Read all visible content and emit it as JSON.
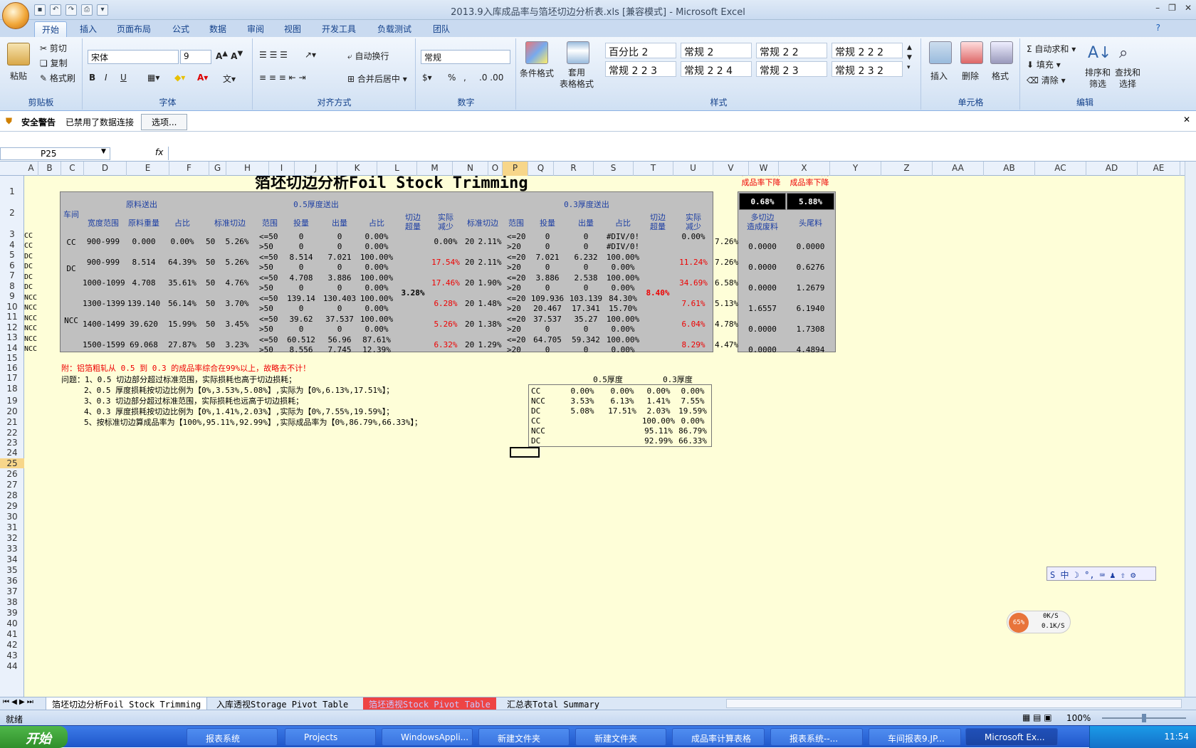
{
  "window": {
    "title": "2013.9入库成品率与箔坯切边分析表.xls  [兼容模式] - Microsoft Excel"
  },
  "ribbon": {
    "tabs": [
      "开始",
      "插入",
      "页面布局",
      "公式",
      "数据",
      "审阅",
      "视图",
      "开发工具",
      "负载测试",
      "团队"
    ],
    "clipboard": {
      "paste": "粘贴",
      "cut": "剪切",
      "copy": "复制",
      "format_painter": "格式刷",
      "label": "剪贴板"
    },
    "font": {
      "name": "宋体",
      "size": "9",
      "label": "字体"
    },
    "alignment": {
      "wrap": "自动换行",
      "merge": "合并后居中",
      "label": "对齐方式"
    },
    "number": {
      "format": "常规",
      "percent": "%",
      "label": "数字"
    },
    "styles": {
      "cond": "条件格式",
      "table": "套用\n表格格式",
      "boxes": [
        "百分比 2",
        "常规 2",
        "常规 2 2",
        "常规 2 2 2",
        "常规 2 2 3",
        "常规 2 2 4",
        "常规 2 3",
        "常规 2 3 2"
      ],
      "label": "样式"
    },
    "cells": {
      "insert": "插入",
      "delete": "删除",
      "format": "格式",
      "label": "单元格"
    },
    "editing": {
      "autosum": "自动求和",
      "fill": "填充",
      "clear": "清除",
      "sort": "排序和\n筛选",
      "find": "查找和\n选择",
      "label": "编辑"
    }
  },
  "security": {
    "title": "安全警告",
    "message": "已禁用了数据连接",
    "options": "选项..."
  },
  "formula": {
    "namebox": "P25",
    "fx": "fx"
  },
  "columns": [
    "A",
    "B",
    "C",
    "D",
    "E",
    "F",
    "G",
    "H",
    "I",
    "J",
    "K",
    "L",
    "M",
    "N",
    "O",
    "P",
    "Q",
    "R",
    "S",
    "T",
    "U",
    "V",
    "W",
    "X",
    "Y",
    "Z",
    "AA",
    "AB",
    "AC",
    "AD",
    "AE"
  ],
  "rows": [
    "1",
    "2",
    "3",
    "4",
    "5",
    "6",
    "7",
    "8",
    "9",
    "10",
    "11",
    "12",
    "13",
    "14",
    "15",
    "16",
    "17",
    "18",
    "19",
    "20",
    "21",
    "22",
    "23",
    "24",
    "25",
    "26",
    "27",
    "28",
    "29",
    "30",
    "31",
    "32",
    "33",
    "34",
    "35",
    "36",
    "37",
    "38",
    "39",
    "40",
    "41",
    "42",
    "43",
    "44"
  ],
  "sheet": {
    "title": "箔坯切边分析Foil Stock Trimming",
    "side_hdr1": "多切边造成\n成品率下降",
    "side_hdr2": "头尾料造成\n成品率下降",
    "side_val1": "0.68%",
    "side_val2": "5.88%",
    "side_sub1": "多切边\n造成废料",
    "side_sub2": "头尾料",
    "hdr": {
      "workshop": "车间",
      "raw": "原料送出",
      "t05": "0.5厚度送出",
      "t03": "0.3厚度送出",
      "width": "宽度范围",
      "rawwt": "原料重量",
      "pct": "占比",
      "std": "标准切边",
      "range": "范围",
      "input": "投量",
      "output": "出量",
      "pct2": "占比",
      "over": "切边\n超量",
      "actual": "实际\n减少",
      "std3": "标准切边",
      "range3": "范围",
      "input3": "投量",
      "output3": "出量",
      "pct3": "占比",
      "over3": "切边\n超量",
      "actual3": "实际\n减少"
    },
    "colC": [
      "CC",
      "CC",
      "DC",
      "DC",
      "DC",
      "DC",
      "NCC",
      "NCC",
      "NCC",
      "NCC",
      "NCC",
      "NCC"
    ],
    "groups": [
      {
        "ws": "CC",
        "rows": [
          {
            "w": "900-999",
            "wt": "0.000",
            "p": "0.00%",
            "s": "50",
            "sp": "5.26%",
            "a": [
              "<=50",
              "0",
              "0",
              "0.00%"
            ],
            "b": [
              ">50",
              "0",
              "0",
              "0.00%"
            ],
            "act": "0.00%",
            "s3": "20",
            "sp3": "2.11%",
            "a3": [
              "<=20",
              "0",
              "0",
              "#DIV/0!"
            ],
            "b3": [
              ">20",
              "0",
              "0",
              "#DIV/0!"
            ],
            "act3": "0.00%",
            "w2": "7.26%",
            "x": "0.0000",
            "y": "0.0000"
          }
        ]
      },
      {
        "ws": "DC",
        "rows": [
          {
            "w": "900-999",
            "wt": "8.514",
            "p": "64.39%",
            "s": "50",
            "sp": "5.26%",
            "a": [
              "<=50",
              "8.514",
              "7.021",
              "100.00%"
            ],
            "b": [
              ">50",
              "0",
              "0",
              "0.00%"
            ],
            "act": "17.54%",
            "s3": "20",
            "sp3": "2.11%",
            "a3": [
              "<=20",
              "7.021",
              "6.232",
              "100.00%"
            ],
            "b3": [
              ">20",
              "0",
              "0",
              "0.00%"
            ],
            "act3": "11.24%",
            "w2": "7.26%",
            "x": "0.0000",
            "y": "0.6276"
          },
          {
            "w": "1000-1099",
            "wt": "4.708",
            "p": "35.61%",
            "s": "50",
            "sp": "4.76%",
            "a": [
              "<=50",
              "4.708",
              "3.886",
              "100.00%"
            ],
            "b": [
              ">50",
              "0",
              "0",
              "0.00%"
            ],
            "act": "17.46%",
            "s3": "20",
            "sp3": "1.90%",
            "a3": [
              "<=20",
              "3.886",
              "2.538",
              "100.00%"
            ],
            "b3": [
              ">20",
              "0",
              "0",
              "0.00%"
            ],
            "act3": "34.69%",
            "w2": "6.58%",
            "x": "0.0000",
            "y": "1.2679"
          }
        ]
      },
      {
        "ws": "NCC",
        "rows": [
          {
            "w": "1300-1399",
            "wt": "139.140",
            "p": "56.14%",
            "s": "50",
            "sp": "3.70%",
            "a": [
              "<=50",
              "139.14",
              "130.403",
              "100.00%"
            ],
            "b": [
              ">50",
              "0",
              "0",
              "0.00%"
            ],
            "act": "6.28%",
            "s3": "20",
            "sp3": "1.48%",
            "a3": [
              "<=20",
              "109.936",
              "103.139",
              "84.30%"
            ],
            "b3": [
              ">20",
              "20.467",
              "17.341",
              "15.70%"
            ],
            "act3": "7.61%",
            "w2": "5.13%",
            "x": "1.6557",
            "y": "6.1940"
          },
          {
            "w": "1400-1499",
            "wt": "39.620",
            "p": "15.99%",
            "s": "50",
            "sp": "3.45%",
            "a": [
              "<=50",
              "39.62",
              "37.537",
              "100.00%"
            ],
            "b": [
              ">50",
              "0",
              "0",
              "0.00%"
            ],
            "act": "5.26%",
            "s3": "20",
            "sp3": "1.38%",
            "a3": [
              "<=20",
              "37.537",
              "35.27",
              "100.00%"
            ],
            "b3": [
              ">20",
              "0",
              "0",
              "0.00%"
            ],
            "act3": "6.04%",
            "w2": "4.78%",
            "x": "0.0000",
            "y": "1.7308"
          },
          {
            "w": "1500-1599",
            "wt": "69.068",
            "p": "27.87%",
            "s": "50",
            "sp": "3.23%",
            "a": [
              "<=50",
              "60.512",
              "56.96",
              "87.61%"
            ],
            "b": [
              ">50",
              "8.556",
              "7.745",
              "12.39%"
            ],
            "act": "6.32%",
            "s3": "20",
            "sp3": "1.29%",
            "a3": [
              "<=20",
              "64.705",
              "59.342",
              "100.00%"
            ],
            "b3": [
              ">20",
              "0",
              "0",
              "0.00%"
            ],
            "act3": "8.29%",
            "w2": "4.47%",
            "x": "0.0000",
            "y": "4.4894"
          }
        ]
      }
    ],
    "over05": "3.28%",
    "over03": "8.40%",
    "note": "附：铝箔粗轧从 0.5 到 0.3 的成品率综合在99%以上，故略去不计！",
    "issues": [
      "问题：1、0.5 切边部分超过标准范围，实际损耗也高于切边损耗；",
      "2、0.5 厚度损耗按切边比例为【0%,3.53%,5.08%】,实际为【0%,6.13%,17.51%】；",
      "3、0.3 切边部分超过标准范围，实际损耗也远高于切边损耗；",
      "4、0.3 厚度损耗按切边比例为【0%,1.41%,2.03%】,实际为【0%,7.55%,19.59%】；",
      "5、按标准切边算成品率为【100%,95.11%,92.99%】,实际成品率为【0%,86.79%,66.33%】；"
    ],
    "small_hdr": [
      "0.5厚度",
      "0.3厚度"
    ],
    "small": [
      [
        "CC",
        "0.00%",
        "0.00%",
        "0.00%",
        "0.00%"
      ],
      [
        "NCC",
        "3.53%",
        "6.13%",
        "1.41%",
        "7.55%"
      ],
      [
        "DC",
        "5.08%",
        "17.51%",
        "2.03%",
        "19.59%"
      ],
      [
        "CC",
        "",
        "",
        "100.00%",
        "0.00%"
      ],
      [
        "NCC",
        "",
        "",
        "95.11%",
        "86.79%"
      ],
      [
        "DC",
        "",
        "",
        "92.99%",
        "66.33%"
      ]
    ]
  },
  "sheet_tabs": [
    "箔坯切边分析Foil Stock Trimming",
    "入库透视Storage Pivot Table",
    "箔坯透视Stock Pivot Table",
    "汇总表Total Summary"
  ],
  "status": {
    "ready": "就绪",
    "zoom": "100%"
  },
  "ime": {
    "net_pct": "65%",
    "up": "0K/S",
    "down": "0.1K/S"
  },
  "taskbar": {
    "start": "开始",
    "items": [
      "报表系统",
      "Projects",
      "WindowsAppli...",
      "新建文件夹",
      "新建文件夹",
      "成品率计算表格",
      "报表系统--...",
      "车间报表9.JP...",
      "Microsoft Ex..."
    ],
    "clock": "11:54"
  }
}
